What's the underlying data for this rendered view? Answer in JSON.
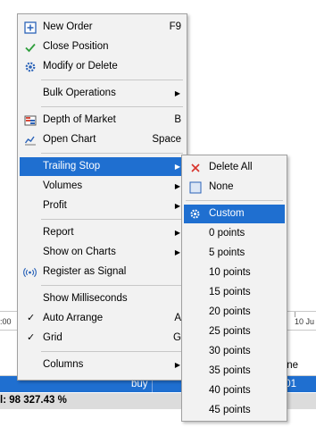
{
  "background": {
    "ruler_left": ":00",
    "ruler_right": "10 Ju",
    "header_col": "ne",
    "row_type": "buy",
    "row_value": "01",
    "status_text": "l: 98 327.43 %"
  },
  "context_menu": {
    "items": [
      {
        "label": "New Order",
        "shortcut": "F9",
        "icon": "new-order-icon"
      },
      {
        "label": "Close Position",
        "icon": "check-icon"
      },
      {
        "label": "Modify or Delete",
        "icon": "gear-icon"
      },
      {
        "label": "Bulk Operations"
      },
      {
        "label": "Depth of Market",
        "shortcut": "B",
        "icon": "depth-of-market-icon"
      },
      {
        "label": "Open Chart",
        "shortcut": "Space",
        "icon": "chart-icon"
      },
      {
        "label": "Trailing Stop"
      },
      {
        "label": "Volumes"
      },
      {
        "label": "Profit"
      },
      {
        "label": "Report"
      },
      {
        "label": "Show on Charts"
      },
      {
        "label": "Register as Signal",
        "icon": "signal-icon"
      },
      {
        "label": "Show Milliseconds"
      },
      {
        "label": "Auto Arrange",
        "shortcut": "A",
        "checked": true
      },
      {
        "label": "Grid",
        "shortcut": "G",
        "checked": true
      },
      {
        "label": "Columns"
      }
    ]
  },
  "trailing_stop_menu": {
    "delete_all": "Delete All",
    "none": "None",
    "custom": "Custom",
    "points": [
      "0 points",
      "5 points",
      "10 points",
      "15 points",
      "20 points",
      "25 points",
      "30 points",
      "35 points",
      "40 points",
      "45 points"
    ]
  },
  "colors": {
    "highlight": "#1f6fd0",
    "menu_bg": "#f2f2f2"
  }
}
